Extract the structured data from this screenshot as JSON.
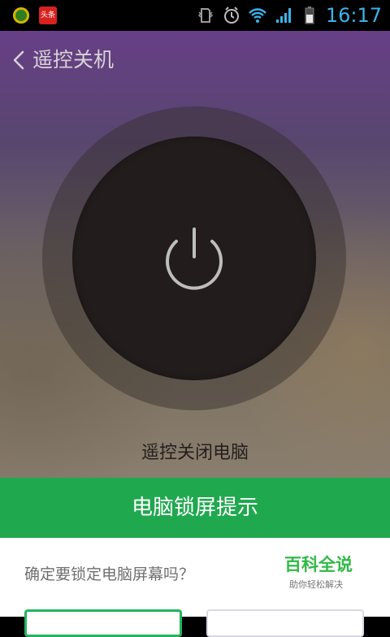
{
  "status_bar": {
    "time": "16:17",
    "left_icons": [
      "app-dot-icon",
      "news-app-icon"
    ],
    "news_app_label": "头条",
    "right_icons": [
      "vibrate-icon",
      "alarm-icon",
      "wifi-icon",
      "signal-icon",
      "battery-icon"
    ],
    "accent": "#39b4ea"
  },
  "header": {
    "title": "遥控关机",
    "back_icon": "chevron-left-icon"
  },
  "main": {
    "power_icon": "power-icon",
    "caption": "遥控关闭电脑"
  },
  "dialog": {
    "title": "电脑锁屏提示",
    "message": "确定要锁定电脑屏幕吗？",
    "brand": "百科全说",
    "brand_subtitle": "助你轻松解决",
    "header_color": "#20a84f",
    "brand_color": "#31b946"
  }
}
